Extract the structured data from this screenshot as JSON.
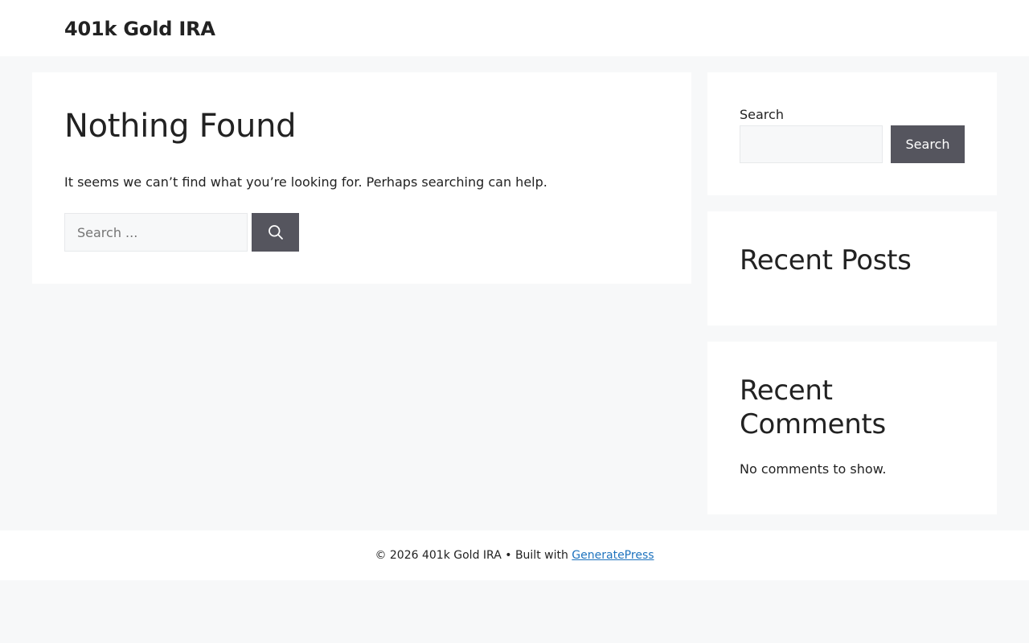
{
  "header": {
    "site_title": "401k Gold IRA"
  },
  "main": {
    "title": "Nothing Found",
    "message": "It seems we can’t find what you’re looking for. Perhaps searching can help.",
    "search_placeholder": "Search ...",
    "search_button_icon": "search-icon"
  },
  "sidebar": {
    "search_label": "Search",
    "search_value": "",
    "search_button_label": "Search",
    "recent_posts_title": "Recent Posts",
    "recent_comments_title": "Recent Comments",
    "no_comments_text": "No comments to show."
  },
  "footer": {
    "copyright": "© 2026 401k Gold IRA",
    "separator": " • Built with ",
    "link_text": "GeneratePress"
  },
  "colors": {
    "page_background": "#f7f8f9",
    "button_background": "#55555e",
    "link": "#1e73be"
  }
}
